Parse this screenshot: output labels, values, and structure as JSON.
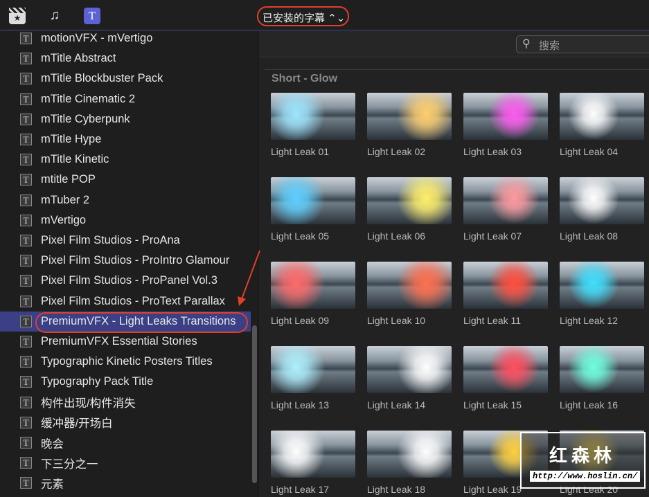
{
  "toolbar": {
    "picker_label": "已安装的字幕 ⌃⌄",
    "icons": [
      "clapper-star-icon",
      "photo-music-icon",
      "titles-icon"
    ],
    "accent": "#5b62d6"
  },
  "sidebar": {
    "items": [
      "motionVFX - mVertigo",
      "mTitle Abstract",
      "mTitle Blockbuster Pack",
      "mTitle Cinematic 2",
      "mTitle Cyberpunk",
      "mTitle Hype",
      "mTitle Kinetic",
      "mtitle POP",
      "mTuber 2",
      "mVertigo",
      "Pixel Film Studios - ProAna",
      "Pixel Film Studios - ProIntro Glamour",
      "Pixel Film Studios - ProPanel Vol.3",
      "Pixel Film Studios - ProText Parallax",
      "PremiumVFX - Light Leaks Transitions",
      "PremiumVFX Essential Stories",
      "Typographic Kinetic Posters Titles",
      "Typography Pack Title",
      "构件出现/构件消失",
      "缓冲器/开场白",
      "晚会",
      "下三分之一",
      "元素"
    ],
    "selected": 14
  },
  "search": {
    "placeholder": "搜索"
  },
  "section": {
    "title": "Short - Glow"
  },
  "tiles": [
    {
      "label": "Light Leak 01",
      "glow": "#9fe6ff"
    },
    {
      "label": "Light Leak 02",
      "glow": "#ffcf70"
    },
    {
      "label": "Light Leak 03",
      "glow": "#ff5cf0"
    },
    {
      "label": "Light Leak 04",
      "glow": "#ffffff"
    },
    {
      "label": "Light Leak 05",
      "glow": "#5fd0ff"
    },
    {
      "label": "Light Leak 06",
      "glow": "#fff06a"
    },
    {
      "label": "Light Leak 07",
      "glow": "#ff9aa0"
    },
    {
      "label": "Light Leak 08",
      "glow": "#ffffff"
    },
    {
      "label": "Light Leak 09",
      "glow": "#ff6a6a"
    },
    {
      "label": "Light Leak 10",
      "glow": "#ff7050"
    },
    {
      "label": "Light Leak 11",
      "glow": "#ff5040"
    },
    {
      "label": "Light Leak 12",
      "glow": "#40e0ff"
    },
    {
      "label": "Light Leak 13",
      "glow": "#aef0ff"
    },
    {
      "label": "Light Leak 14",
      "glow": "#ffffff"
    },
    {
      "label": "Light Leak 15",
      "glow": "#ff5060"
    },
    {
      "label": "Light Leak 16",
      "glow": "#70ffe0"
    },
    {
      "label": "Light Leak 17",
      "glow": "#ffffff"
    },
    {
      "label": "Light Leak 18",
      "glow": "#ffffff"
    },
    {
      "label": "Light Leak 19",
      "glow": "#ffd040"
    },
    {
      "label": "Light Leak 20",
      "glow": "#ffe060"
    }
  ],
  "watermark": {
    "title": "红森林",
    "url": "http://www.hoslin.cn/"
  }
}
